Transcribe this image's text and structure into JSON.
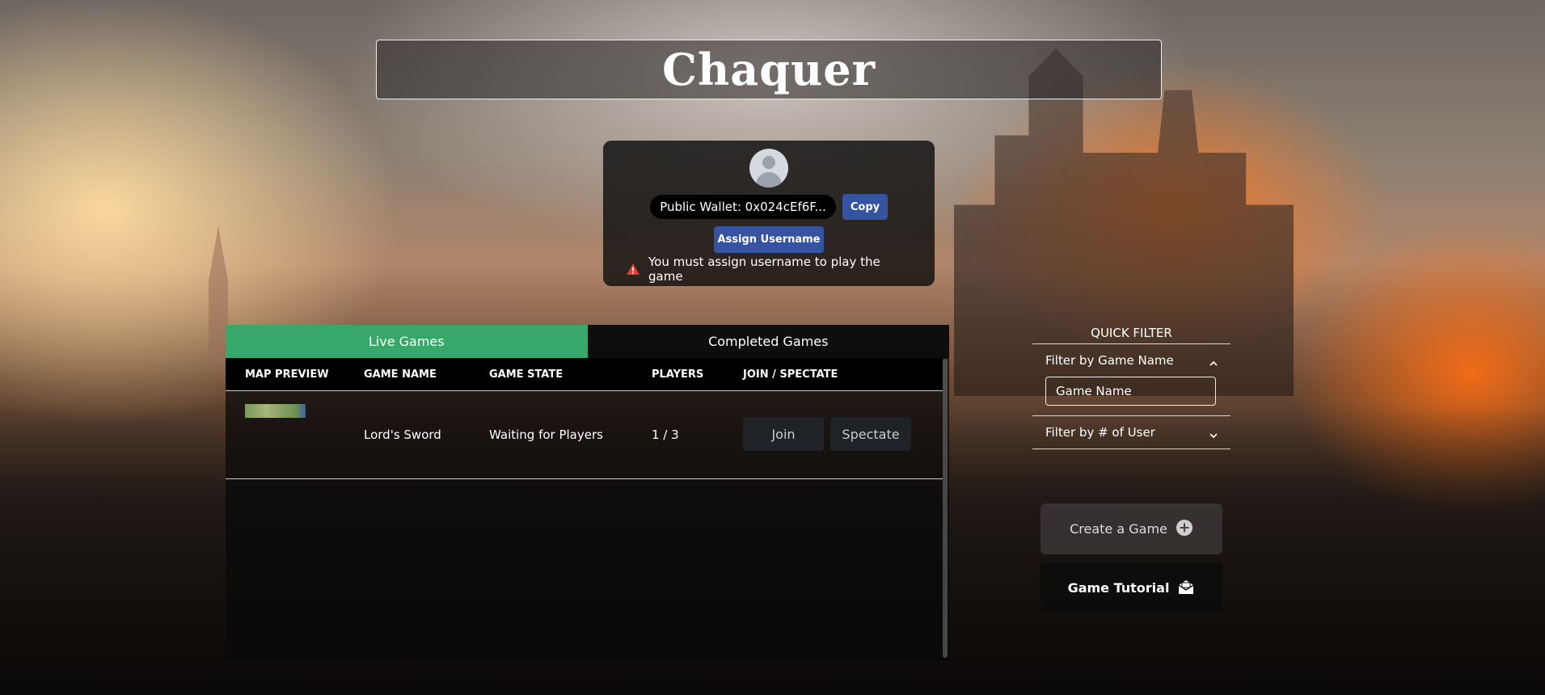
{
  "header": {
    "title": "Chaquer"
  },
  "profile": {
    "wallet_label": "Public Wallet: 0x024cEf6F...",
    "copy_label": "Copy",
    "assign_label": "Assign Username",
    "warning": "You must assign username to play the game"
  },
  "tabs": {
    "live": "Live Games",
    "completed": "Completed Games",
    "active": "live"
  },
  "table": {
    "columns": [
      "MAP PREVIEW",
      "GAME NAME",
      "GAME STATE",
      "PLAYERS",
      "JOIN / SPECTATE"
    ],
    "rows": [
      {
        "game_name": "Lord's Sword",
        "game_state": "Waiting for Players",
        "players": "1 / 3",
        "join_label": "Join",
        "spectate_label": "Spectate"
      }
    ]
  },
  "quick_filter": {
    "title": "QUICK FILTER",
    "by_name_label": "Filter by Game Name",
    "name_placeholder": "Game Name",
    "by_users_label": "Filter by # of User"
  },
  "actions": {
    "create_label": "Create a Game",
    "tutorial_label": "Game Tutorial"
  },
  "colors": {
    "accent_green": "#37a76a",
    "button_blue": "#3553a0",
    "warning_red": "#e53935"
  },
  "icons": {
    "avatar": "user-avatar-icon",
    "warning": "warning-triangle-icon",
    "expand": "chevron-icon",
    "create": "plus-circle-icon",
    "tutorial": "envelope-open-icon"
  }
}
